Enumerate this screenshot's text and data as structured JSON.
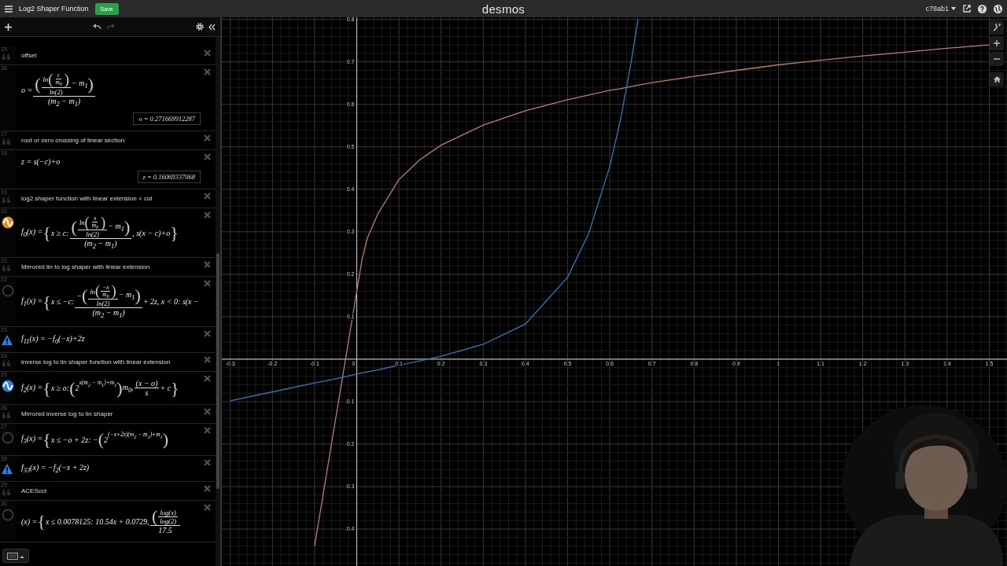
{
  "top_bar": {
    "title": "Log2 Shaper Function",
    "save": "Save",
    "logo": "desmos",
    "account": "c78ab1"
  },
  "expression_list": {
    "rows": [
      {
        "number": "15",
        "kind": "note",
        "text": "offset"
      },
      {
        "number": "16",
        "kind": "expression",
        "math": [
          "o = ",
          {
            "frac": [
              [
                {
                  "big": "("
                },
                {
                  "frac": [
                    [
                      "ln",
                      {
                        "big": "("
                      },
                      {
                        "frac": [
                          [
                            "c"
                          ],
                          [
                            "m$_{0}$"
                          ]
                        ]
                      },
                      {
                        "big": ")"
                      }
                    ],
                    [
                      "ln(2)"
                    ]
                  ]
                },
                " − m$_{1}$",
                {
                  "big": ")"
                }
              ],
              [
                "(m$_{2}$ − m$_{1}$)"
              ]
            ]
          }
        ],
        "value": "o = 0.271669912287"
      },
      {
        "number": "17",
        "kind": "note",
        "text": "root or zero crossing of linear section"
      },
      {
        "number": "18",
        "kind": "expression",
        "math": [
          "z = s(−c)+o"
        ],
        "value": "z = 0.16069337068"
      },
      {
        "number": "19",
        "kind": "note",
        "text": "log2 shaper function with linear extension < cut"
      },
      {
        "number": "20",
        "kind": "expression",
        "visible": true,
        "color": "#e8892c",
        "math": [
          "f$_{0}$(x) = ",
          {
            "big": "{"
          },
          "x ≥ c: ",
          {
            "frac": [
              [
                {
                  "big": "("
                },
                {
                  "frac": [
                    [
                      "ln",
                      {
                        "big": "("
                      },
                      {
                        "frac": [
                          [
                            "x"
                          ],
                          [
                            "m$_{0}$"
                          ]
                        ]
                      },
                      {
                        "big": ")"
                      }
                    ],
                    [
                      "ln(2)"
                    ]
                  ]
                },
                " − m$_{1}$",
                {
                  "big": ")"
                }
              ],
              [
                "(m$_{2}$ − m$_{1}$)"
              ]
            ]
          },
          ", s(x − c)+o",
          {
            "big": "}"
          }
        ]
      },
      {
        "number": "21",
        "kind": "note",
        "text": "Mirrored lin to log shaper with linear extension"
      },
      {
        "number": "22",
        "kind": "expression",
        "visible": false,
        "math": [
          "f$_{1}$(x) = ",
          {
            "big": "{"
          },
          "x ≤ −c: ",
          {
            "frac": [
              [
                "−",
                {
                  "big": "("
                },
                {
                  "frac": [
                    [
                      "ln",
                      {
                        "big": "("
                      },
                      {
                        "frac": [
                          [
                            "−x"
                          ],
                          [
                            "m$_{0}$"
                          ]
                        ]
                      },
                      {
                        "big": ")"
                      }
                    ],
                    [
                      "ln(2)"
                    ]
                  ]
                },
                " − m$_{1}$",
                {
                  "big": ")"
                }
              ],
              [
                "(m$_{2}$ − m$_{1}$)"
              ]
            ]
          },
          " + 2z, x < 0: s(x −"
        ]
      },
      {
        "number": "23",
        "kind": "expression",
        "warning": true,
        "math": [
          "f$_{11}$(x) = −f$_{0}$(−x)+2z"
        ]
      },
      {
        "number": "24",
        "kind": "note",
        "text": "inverse log to lin shaper function with linear extension"
      },
      {
        "number": "25",
        "kind": "expression",
        "visible": true,
        "color": "#2f7fd6",
        "math": [
          "f$_{2}$(x) = ",
          {
            "big": "{"
          },
          "x ≥ o: ",
          {
            "big": "("
          },
          "2",
          {
            "sup": [
              "x(m$_{2}$ − m$_{1}$)+m$_{1}$"
            ]
          },
          {
            "big": ")"
          },
          "m$_{0}$, ",
          {
            "frac": [
              [
                "(x − o)"
              ],
              [
                "s"
              ]
            ]
          },
          " + c",
          {
            "big": "}"
          }
        ]
      },
      {
        "number": "26",
        "kind": "note",
        "text": "Mirrored inverse log to lin shaper"
      },
      {
        "number": "27",
        "kind": "expression",
        "visible": false,
        "math": [
          "f$_{3}$(x) = ",
          {
            "big": "{"
          },
          "x ≤ −o + 2z: −",
          {
            "big": "("
          },
          "2",
          {
            "sup": [
              "(−x+2z)(m$_{2}$ − m$_{1}$)+m$_{1}$"
            ]
          },
          {
            "big": ")"
          }
        ]
      },
      {
        "number": "28",
        "kind": "expression",
        "warning": true,
        "math": [
          "f$_{33}$(x) = −f$_{2}$(−x + 2z)"
        ]
      },
      {
        "number": "29",
        "kind": "note",
        "text": "ACEScct"
      },
      {
        "number": "30",
        "kind": "expression",
        "visible": false,
        "math": [
          "(x) = ",
          {
            "big": "{"
          },
          "x ≤ 0.0078125: 10.54x + 0.0729, ",
          {
            "frac": [
              [
                {
                  "big": "("
                },
                {
                  "frac": [
                    [
                      "log(x)"
                    ],
                    [
                      "log(2)"
                    ]
                  ]
                }
              ],
              [
                "17.5"
              ]
            ]
          }
        ]
      }
    ]
  },
  "graph": {
    "chart_data": {
      "type": "line",
      "x": [
        -0.3,
        -0.2,
        -0.1,
        -0.05,
        0,
        0.0125,
        0.025,
        0.05,
        0.1,
        0.15,
        0.2,
        0.3,
        0.4,
        0.5,
        0.55,
        0.6,
        0.625,
        0.65,
        0.667,
        0.7,
        0.8,
        0.9,
        1,
        1.1,
        1.2,
        1.3,
        1.4,
        1.5
      ],
      "series": [
        {
          "color": "#b7826a",
          "values": [
            null,
            null,
            -0.44,
            -0.14,
            0.16,
            0.235,
            0.285,
            0.342,
            0.423,
            0.47,
            0.504,
            0.551,
            0.585,
            0.611,
            0.622,
            0.633,
            0.637,
            0.642,
            0.645,
            0.651,
            0.666,
            0.68,
            0.693,
            0.704,
            0.714,
            0.723,
            0.732,
            0.74
          ]
        },
        {
          "color": "#3a75b8",
          "values": [
            -0.098,
            -0.077,
            -0.056,
            -0.046,
            -0.035,
            -0.032,
            -0.03,
            -0.025,
            -0.014,
            -0.004,
            0.007,
            0.035,
            0.083,
            0.193,
            0.296,
            0.454,
            0.562,
            0.696,
            0.8,
            null,
            null,
            null,
            null,
            null,
            null,
            null,
            null,
            null
          ]
        }
      ],
      "grid": true,
      "xlim": [
        -0.32,
        1.542
      ],
      "ylim": [
        -0.487,
        0.805
      ],
      "xticks": [
        -0.3,
        -0.2,
        -0.1,
        0,
        0.1,
        0.2,
        0.3,
        0.4,
        0.5,
        0.6,
        0.7,
        0.8,
        0.9,
        1,
        1.1,
        1.2,
        1.3,
        1.4,
        1.5
      ],
      "yticks": [
        -0.4,
        -0.3,
        -0.2,
        -0.1,
        0.1,
        0.2,
        0.3,
        0.4,
        0.5,
        0.6,
        0.7,
        0.8
      ]
    }
  }
}
